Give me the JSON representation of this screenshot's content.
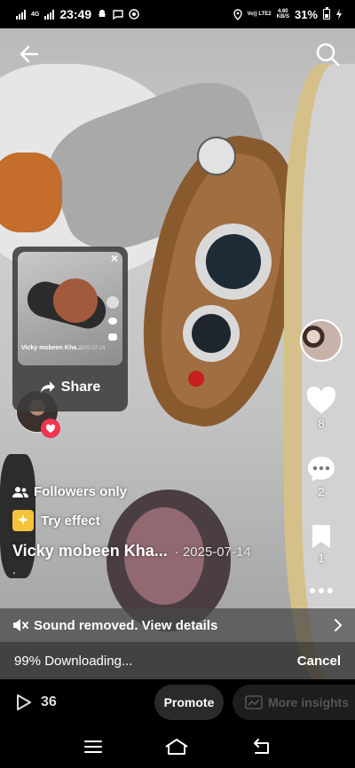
{
  "status_bar": {
    "network": "4G",
    "time": "23:49",
    "volte": "Vo)) LTE2",
    "speed_value": "4.60",
    "speed_unit": "KB/S",
    "battery": "31%"
  },
  "share_popup": {
    "share_label": "Share",
    "thumb_author": "Vicky mobeen Kha...",
    "thumb_date": "2025-07-14"
  },
  "rail": {
    "likes": "8",
    "comments": "2",
    "saves": "1"
  },
  "info": {
    "followers_label": "Followers only",
    "effect_label": "Try effect",
    "author": "Vicky mobeen Kha...",
    "date": "· 2025-07-14",
    "caption": "."
  },
  "sound_bar": {
    "text": "Sound removed. View details"
  },
  "download": {
    "progress_text": "99% Downloading...",
    "cancel_label": "Cancel",
    "progress": 0.99
  },
  "action_bar": {
    "views": "36",
    "promote_label": "Promote",
    "insights_label": "More insights"
  },
  "icons": {
    "back": "arrow-left-icon",
    "search": "search-icon",
    "like": "heart-icon",
    "comment": "comment-icon",
    "save": "bookmark-icon",
    "more": "more-dots-icon",
    "share": "share-arrow-icon",
    "followers": "people-icon",
    "effect": "sparkle-icon",
    "mute": "speaker-muted-icon",
    "play": "play-icon",
    "insights": "chart-icon"
  },
  "colors": {
    "like_badge": "#f0354f",
    "effect_badge": "#f5c23a"
  }
}
